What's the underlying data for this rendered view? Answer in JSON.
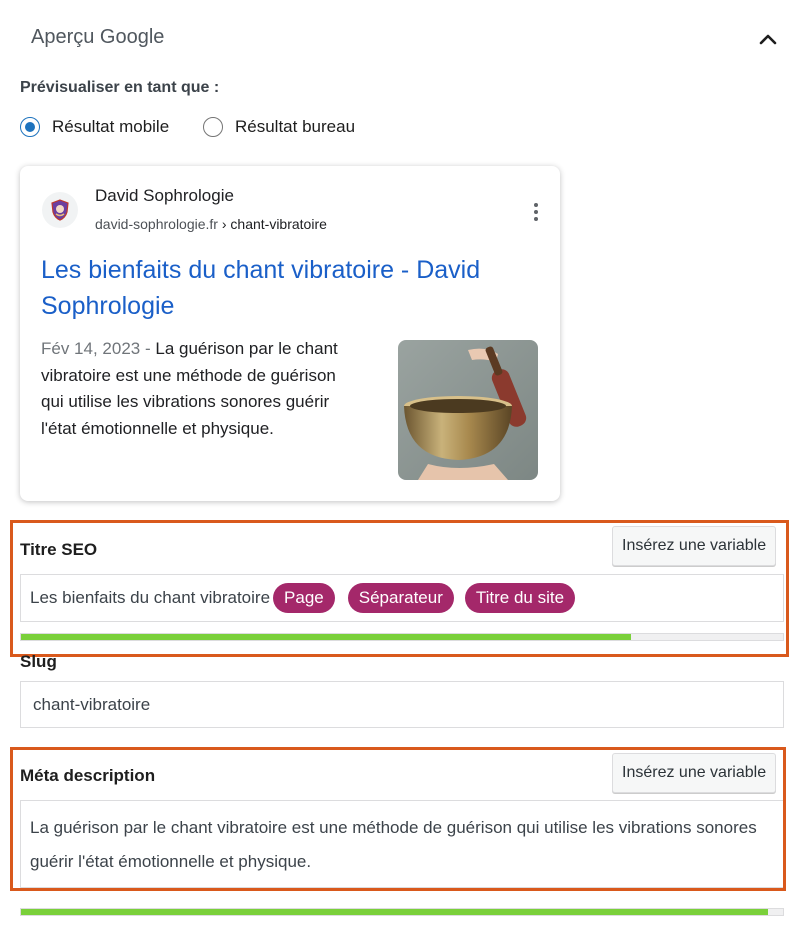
{
  "header": {
    "title": "Aperçu Google",
    "collapse_icon": "chevron-up-icon"
  },
  "preview": {
    "label": "Prévisualiser en tant que :",
    "options": [
      {
        "label": "Résultat mobile",
        "selected": true
      },
      {
        "label": "Résultat bureau",
        "selected": false
      }
    ]
  },
  "google_card": {
    "site_name": "David Sophrologie",
    "domain": "david-sophrologie.fr",
    "path": " › chant-vibratoire",
    "title": "Les bienfaits du chant vibratoire - David Sophrologie",
    "date": "Fév 14, 2023",
    "date_separator": " - ",
    "description": "La guérison par le chant vibratoire est une méthode de guérison qui utilise les vibrations sonores guérir l'état émotionnelle et physique.",
    "favicon_icon": "site-logo-icon",
    "menu_icon": "more-vertical-icon"
  },
  "seo_title": {
    "label": "Titre SEO",
    "insert_button": "Insérez une variable",
    "text": "Les bienfaits du chant vibratoire",
    "tags": [
      "Page",
      "Séparateur",
      "Titre du site"
    ],
    "progress": 0.8
  },
  "slug": {
    "label": "Slug",
    "value": "chant-vibratoire"
  },
  "meta_description": {
    "label": "Méta description",
    "insert_button": "Insérez une variable",
    "text": "La guérison par le chant vibratoire est une méthode de guérison qui utilise les vibrations sonores guérir l'état émotionnelle et physique.",
    "progress": 0.98
  },
  "colors": {
    "accent": "#1e73be",
    "link": "#1a5fc8",
    "tag": "#a4286a",
    "progress_good": "#7ad03a",
    "highlight": "#d9591c"
  }
}
